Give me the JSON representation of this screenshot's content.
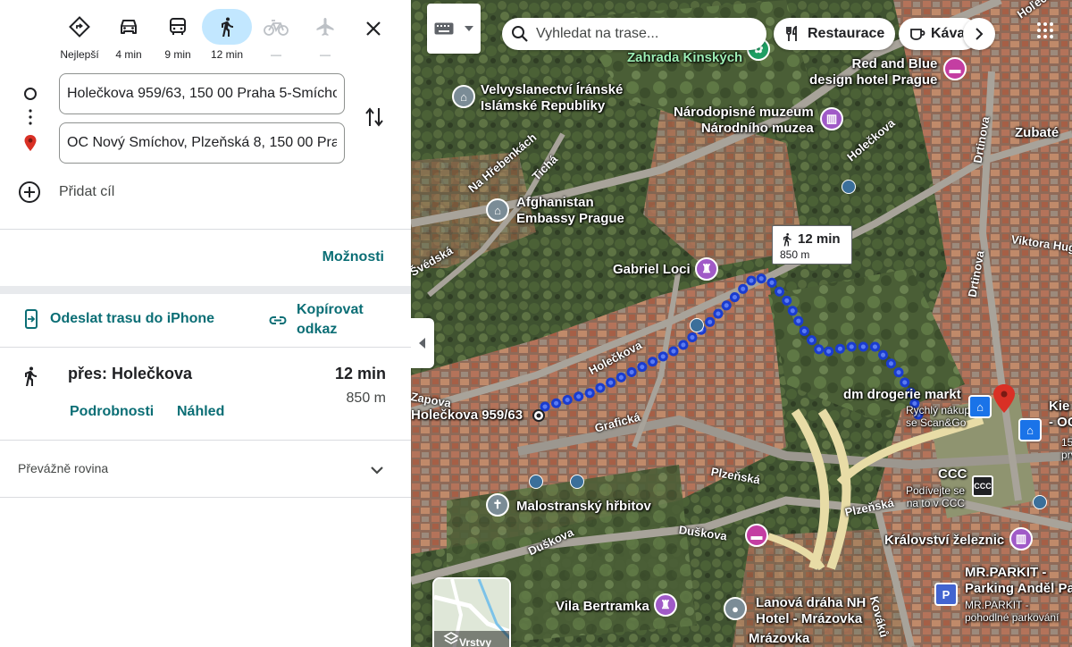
{
  "travel_modes": [
    {
      "name": "best",
      "label": "Nejlepší"
    },
    {
      "name": "car",
      "label": "4 min"
    },
    {
      "name": "transit",
      "label": "9 min"
    },
    {
      "name": "walk",
      "label": "12 min"
    },
    {
      "name": "bike",
      "label": "—"
    },
    {
      "name": "flight",
      "label": "—"
    }
  ],
  "origin": {
    "value": "Holečkova 959/63, 150 00 Praha 5-Smíchov"
  },
  "destination": {
    "value": "OC Nový Smíchov, Plzeňská 8, 150 00 Praha 5"
  },
  "add_destination_label": "Přidat cíl",
  "options_label": "Možnosti",
  "send_to_phone_label": "Odeslat trasu do iPhone",
  "copy_link_label": "Kopírovat odkaz",
  "route": {
    "via": "přes: Holečkova",
    "time": "12 min",
    "distance": "850 m",
    "details_label": "Podrobnosti",
    "preview_label": "Náhled",
    "terrain": "Převážně rovina"
  },
  "map": {
    "search_placeholder": "Vyhledat na trase...",
    "chips": [
      "Restaurace",
      "Káva"
    ],
    "layers_label": "Vrstvy",
    "bubble_time": "12 min",
    "bubble_distance": "850 m",
    "labels": {
      "zahrada": "Zahrada Kinských",
      "hotel_red_blue": "Red and Blue\ndesign hotel Prague",
      "iran_embassy": "Velvyslanectví Íránské\nIslámské Republiky",
      "narodopisne": "Národopisné muzeum\nNárodního muzea",
      "afghan": "Afghanistan\nEmbassy Prague",
      "gabriel": "Gabriel Loci",
      "dm": "dm drogerie markt",
      "dm_sub": "Rychlý nákup\nse Scan&Go",
      "kiehls": "Kie\n- OC",
      "kiehls_sub": "15%\nprvn",
      "origin_label": "Holečkova 959/63",
      "ccc": "CCC",
      "ccc_sub": "Podívejte se\nna to v CCC",
      "malostransky": "Malostranský hřbitov",
      "kralovstvi": "Království železnic",
      "mrparkit": "MR.PARKIT -\nParking Anděl Pa",
      "mrparkit_sub": "MR.PARKIT -\npohodlné parkování",
      "vila": "Vila Bertramka",
      "lanova": "Lanová dráha NH\nHotel - Mrázovka",
      "mrazovka": "Mrázovka",
      "zubate": "Zubaté"
    },
    "streets": {
      "holeckova_top": "Hoľečkova",
      "holeckova_mid": "Holečkova",
      "holeckova_low": "Holečkova",
      "na_hrebenkach": "Na Hřebenkách",
      "ticha": "Tichá",
      "vedska": "Švédská",
      "grafická": "Grafická",
      "plzenska1": "Plzeňská",
      "plzenska2": "Plzeňská",
      "duskova1": "Duškova",
      "duskova2": "Duškova",
      "drtinova1": "Drtinova",
      "drtinova2": "Drtinova",
      "viktora": "Viktora Huga",
      "kovaku": "Kováků",
      "zapova": "Zapova"
    },
    "pin_color": "#d93025",
    "route_color": "#1a3ccf"
  }
}
